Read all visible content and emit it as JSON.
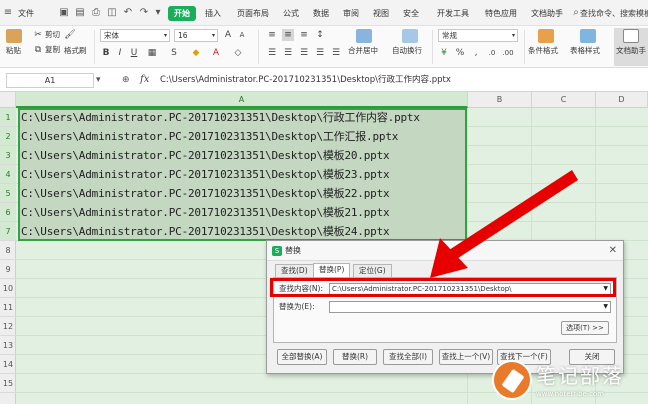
{
  "menubar": {
    "file_label": "文件",
    "tabs": [
      "开始",
      "插入",
      "页面布局",
      "公式",
      "数据",
      "审阅",
      "视图",
      "安全",
      "开发工具",
      "特色应用",
      "文档助手"
    ],
    "active_tab": "开始",
    "search_label": "查找命令、搜索模板"
  },
  "ribbon": {
    "paste_label": "粘贴",
    "cut_label": "剪切",
    "copy_label": "复制",
    "format_painter_label": "格式刷",
    "font_name": "宋体",
    "font_size": "16",
    "merge_label": "合并居中",
    "wrap_label": "自动换行",
    "number_format": "常规",
    "conditional_label": "条件格式",
    "table_style_label": "表格样式",
    "doc_helper_label": "文档助手"
  },
  "formula_bar": {
    "cell_ref": "A1",
    "fx_label": "fx",
    "content": "C:\\Users\\Administrator.PC-201710231351\\Desktop\\行政工作内容.pptx"
  },
  "grid": {
    "columns": [
      "A",
      "B",
      "C",
      "D"
    ],
    "rows": [
      "1",
      "2",
      "3",
      "4",
      "5",
      "6",
      "7",
      "8",
      "9",
      "10",
      "11",
      "12",
      "13",
      "14",
      "15"
    ],
    "cells": [
      "C:\\Users\\Administrator.PC-201710231351\\Desktop\\行政工作内容.pptx",
      "C:\\Users\\Administrator.PC-201710231351\\Desktop\\工作汇报.pptx",
      "C:\\Users\\Administrator.PC-201710231351\\Desktop\\模板20.pptx",
      "C:\\Users\\Administrator.PC-201710231351\\Desktop\\模板23.pptx",
      "C:\\Users\\Administrator.PC-201710231351\\Desktop\\模板22.pptx",
      "C:\\Users\\Administrator.PC-201710231351\\Desktop\\模板21.pptx",
      "C:\\Users\\Administrator.PC-201710231351\\Desktop\\模板24.pptx"
    ]
  },
  "dialog": {
    "title": "替换",
    "tabs": [
      "查找(D)",
      "替换(P)",
      "定位(G)"
    ],
    "active_tab": "替换(P)",
    "find_label": "查找内容(N):",
    "find_value": "C:\\Users\\Administrator.PC-201710231351\\Desktop\\",
    "replace_label": "替换为(E):",
    "replace_value": "",
    "options_label": "选项(T) >>",
    "buttons": [
      "全部替换(A)",
      "替换(R)",
      "查找全部(I)",
      "查找上一个(V)",
      "查找下一个(F)",
      "关闭"
    ]
  },
  "watermark": {
    "name": "笔记部落",
    "url": "www.notetribe.com"
  },
  "colors": {
    "accent_green": "#1aad5c",
    "selection_border": "#35a044",
    "highlight_red": "#e60000",
    "sheet_bg": "#e1f0e0"
  }
}
